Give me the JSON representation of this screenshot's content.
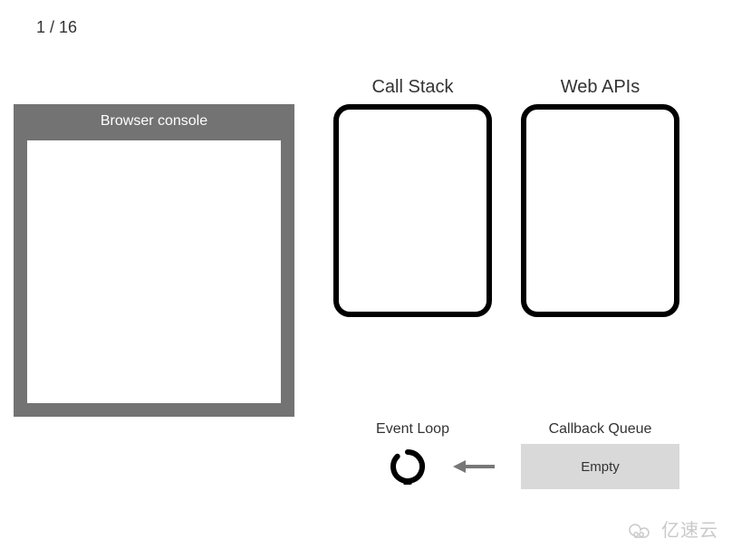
{
  "counter": {
    "current": 1,
    "total": 16,
    "text": "1 / 16"
  },
  "browserConsole": {
    "title": "Browser console"
  },
  "callStack": {
    "heading": "Call Stack"
  },
  "webApis": {
    "heading": "Web APIs"
  },
  "eventLoop": {
    "label": "Event Loop"
  },
  "callbackQueue": {
    "label": "Callback Queue",
    "status": "Empty"
  },
  "watermark": {
    "text": "亿速云"
  }
}
